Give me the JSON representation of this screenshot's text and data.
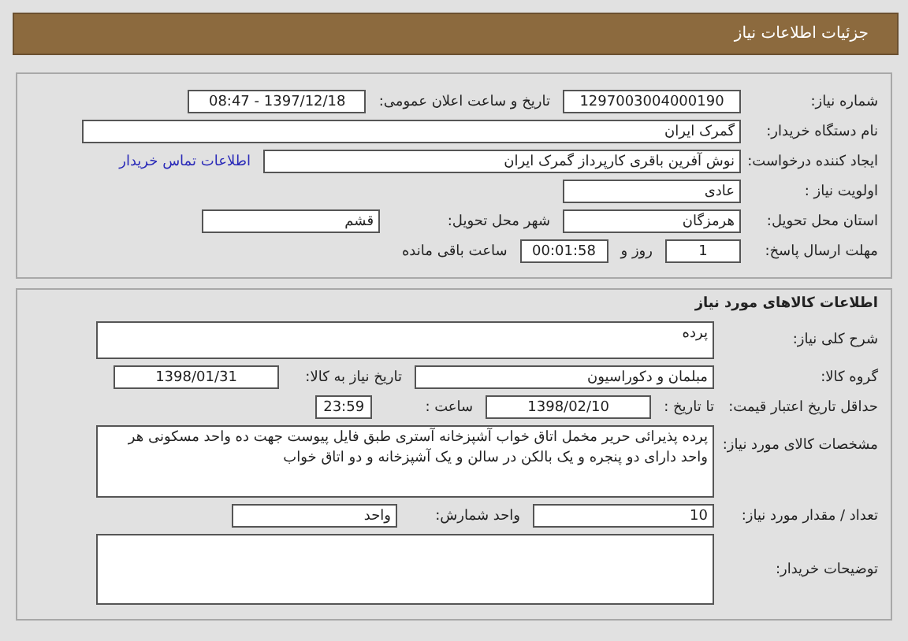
{
  "header": {
    "title": "جزئیات اطلاعات نیاز"
  },
  "details": {
    "need_number": {
      "label": "شماره نیاز:",
      "value": "1297003004000190"
    },
    "announce": {
      "label": "تاریخ و ساعت اعلان عمومی:",
      "value": "1397/12/18 - 08:47"
    },
    "buyer_org": {
      "label": "نام دستگاه خریدار:",
      "value": "گمرک ایران"
    },
    "requester": {
      "label": "ایجاد کننده درخواست:",
      "value": "نوش آفرین باقری کارپرداز گمرک ایران",
      "link": "اطلاعات تماس خریدار"
    },
    "priority": {
      "label": "اولویت نیاز :",
      "value": "عادی"
    },
    "province": {
      "label": "استان محل تحویل:",
      "value": "هرمزگان"
    },
    "city": {
      "label": "شهر محل تحویل:",
      "value": "قشم"
    },
    "deadline": {
      "label": "مهلت ارسال پاسخ:",
      "days": "1",
      "days_unit": "روز و",
      "time": "00:01:58",
      "time_suffix": "ساعت باقی مانده"
    }
  },
  "goods": {
    "title": "اطلاعات کالاهای مورد نیاز",
    "general": {
      "label": "شرح کلی نیاز:",
      "value": "پرده"
    },
    "group": {
      "label": "گروه کالا:",
      "value": "مبلمان و دکوراسیون"
    },
    "need_date": {
      "label": "تاریخ نیاز به کالا:",
      "value": "1398/01/31"
    },
    "price_validity": {
      "label": "حداقل تاریخ اعتبار قیمت:",
      "to_date_label": "تا تاریخ :",
      "date": "1398/02/10",
      "time_label": "ساعت :",
      "time": "23:59"
    },
    "specs": {
      "label": "مشخصات کالای مورد نیاز:",
      "value": "پرده پذیرائی حریر مخمل اتاق خواب آشپزخانه آستری طبق فایل پیوست جهت ده واحد مسکونی هر واحد دارای دو پنجره و یک بالکن در سالن و یک آشپزخانه و دو اتاق خواب"
    },
    "quantity": {
      "label": "تعداد / مقدار مورد نیاز:",
      "value": "10"
    },
    "unit": {
      "label": "واحد شمارش:",
      "value": "واحد"
    },
    "notes": {
      "label": "توضیحات خریدار:"
    }
  }
}
